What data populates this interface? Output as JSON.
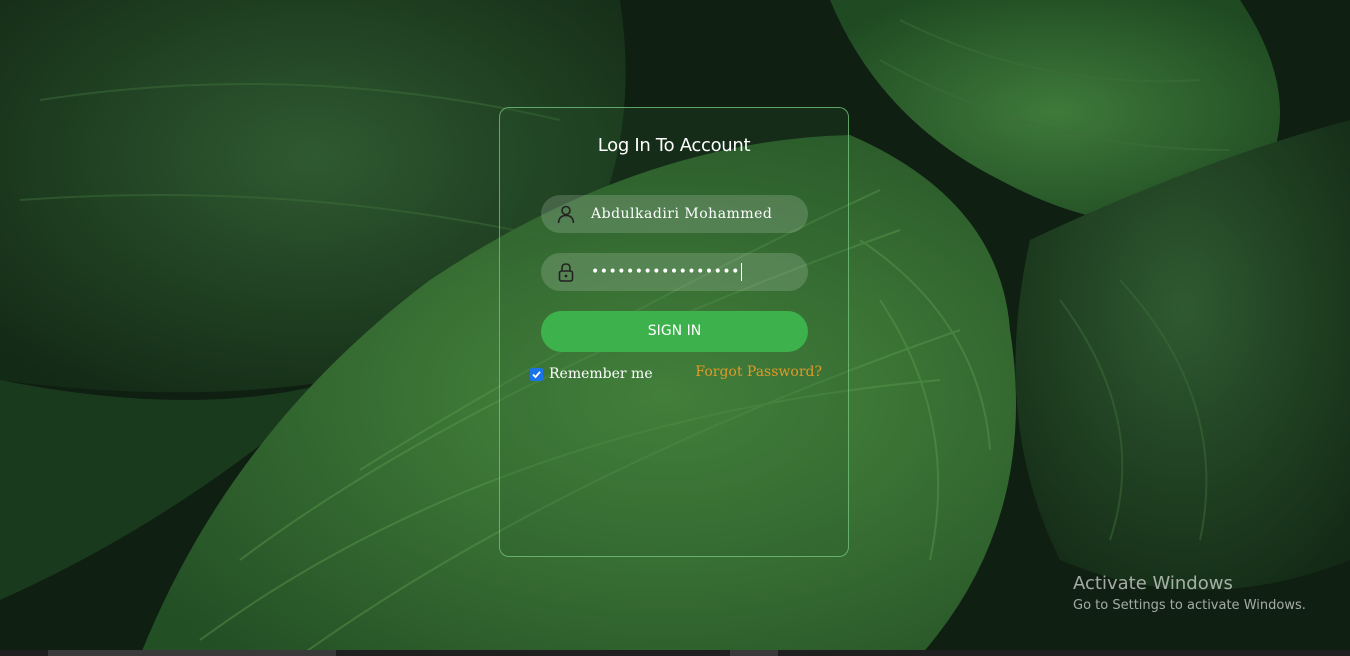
{
  "login": {
    "title": "Log In To Account",
    "username_value": "Abdulkadiri Mohammed",
    "password_value": "•••••••••••••••••",
    "signin_label": "SIGN IN",
    "remember_label": "Remember me",
    "remember_checked": true,
    "forgot_label": "Forgot Password?"
  },
  "icons": {
    "user": "user-icon",
    "lock": "lock-icon",
    "check": "checkmark-icon"
  },
  "colors": {
    "accent_green": "#3cb14c",
    "forgot_link": "#e09a2a",
    "checkbox_blue": "#1a73e8"
  },
  "watermark": {
    "line1": "Activate Windows",
    "line2": "Go to Settings to activate Windows."
  }
}
